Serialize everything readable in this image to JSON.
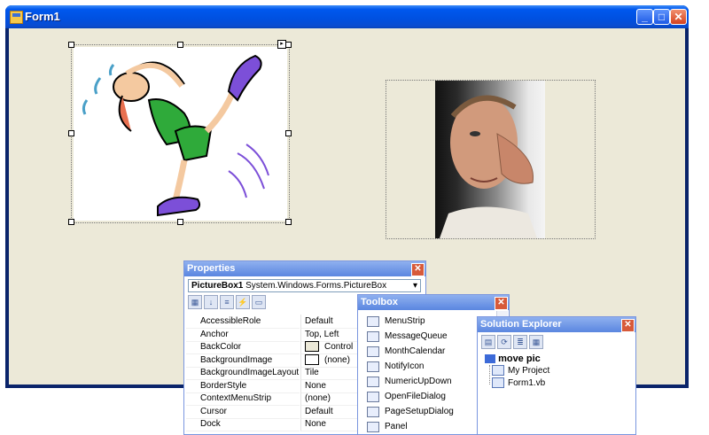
{
  "form": {
    "title": "Form1",
    "buttons": {
      "minimize": "_",
      "maximize": "□",
      "close": "✕"
    }
  },
  "properties": {
    "title": "Properties",
    "object_name": "PictureBox1",
    "object_type": "System.Windows.Forms.PictureBox",
    "rows": [
      {
        "name": "AccessibleRole",
        "value": "Default"
      },
      {
        "name": "Anchor",
        "value": "Top, Left"
      },
      {
        "name": "BackColor",
        "value": "Control",
        "swatch": true
      },
      {
        "name": "BackgroundImage",
        "value": "(none)",
        "swatch": true
      },
      {
        "name": "BackgroundImageLayout",
        "value": "Tile"
      },
      {
        "name": "BorderStyle",
        "value": "None"
      },
      {
        "name": "ContextMenuStrip",
        "value": "(none)"
      },
      {
        "name": "Cursor",
        "value": "Default"
      },
      {
        "name": "Dock",
        "value": "None"
      }
    ]
  },
  "toolbox": {
    "title": "Toolbox",
    "items": [
      {
        "label": "MenuStrip",
        "icon": "menustrip-icon"
      },
      {
        "label": "MessageQueue",
        "icon": "messagequeue-icon"
      },
      {
        "label": "MonthCalendar",
        "icon": "monthcalendar-icon"
      },
      {
        "label": "NotifyIcon",
        "icon": "notifyicon-icon"
      },
      {
        "label": "NumericUpDown",
        "icon": "numericupdown-icon"
      },
      {
        "label": "OpenFileDialog",
        "icon": "openfiledialog-icon"
      },
      {
        "label": "PageSetupDialog",
        "icon": "pagesetupdialog-icon"
      },
      {
        "label": "Panel",
        "icon": "panel-icon"
      }
    ]
  },
  "solution_explorer": {
    "title": "Solution Explorer",
    "project": "move pic",
    "items": [
      {
        "label": "My Project",
        "icon": "my-project-icon"
      },
      {
        "label": "Form1.vb",
        "icon": "form-file-icon"
      }
    ]
  },
  "colors": {
    "titlebar": "#0058ee",
    "form_bg": "#ece9d8",
    "toolwindow_title": "#6a90e3",
    "close_red": "#d75a3a"
  }
}
